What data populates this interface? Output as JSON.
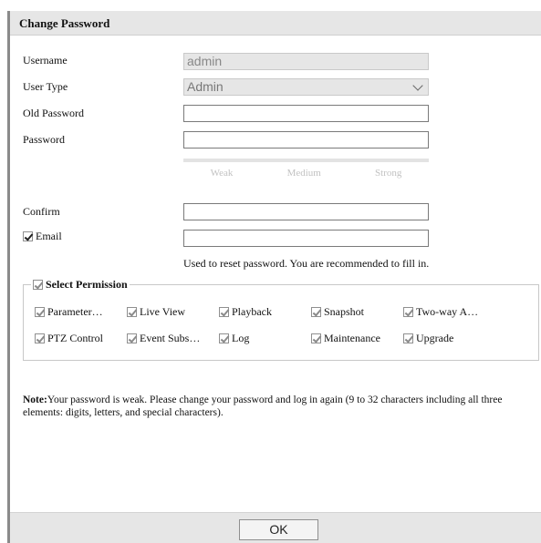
{
  "dialog": {
    "title": "Change Password",
    "username": {
      "label": "Username",
      "value": "admin"
    },
    "user_type": {
      "label": "User Type",
      "value": "Admin"
    },
    "old_password": {
      "label": "Old Password",
      "value": ""
    },
    "password": {
      "label": "Password",
      "value": ""
    },
    "strength": {
      "weak": "Weak",
      "medium": "Medium",
      "strong": "Strong"
    },
    "confirm": {
      "label": "Confirm",
      "value": ""
    },
    "email": {
      "label": "Email",
      "checked": true,
      "value": ""
    },
    "email_hint": "Used to reset password. You are recommended to fill in.",
    "permission": {
      "legend": "Select Permission",
      "row1": [
        "Parameter…",
        "Live View",
        "Playback",
        "Snapshot",
        "Two-way A…"
      ],
      "row2": [
        "PTZ Control",
        "Event Subs…",
        "Log",
        "Maintenance",
        "Upgrade"
      ]
    },
    "note": {
      "label": "Note:",
      "text": "Your password is weak. Please change your password and log in again (9 to 32 characters including all three elements: digits, letters, and special characters)."
    },
    "ok_label": "OK"
  }
}
